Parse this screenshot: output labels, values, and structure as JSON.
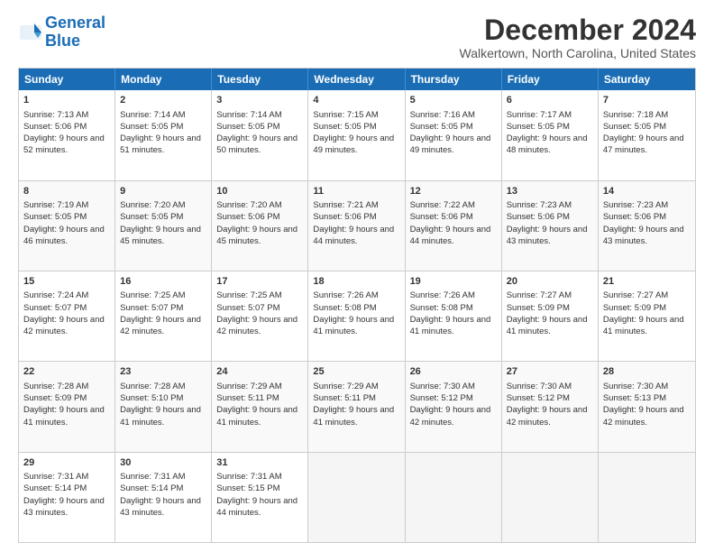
{
  "header": {
    "logo_line1": "General",
    "logo_line2": "Blue",
    "month": "December 2024",
    "location": "Walkertown, North Carolina, United States"
  },
  "days": [
    "Sunday",
    "Monday",
    "Tuesday",
    "Wednesday",
    "Thursday",
    "Friday",
    "Saturday"
  ],
  "weeks": [
    [
      {
        "day": "1",
        "sunrise": "Sunrise: 7:13 AM",
        "sunset": "Sunset: 5:06 PM",
        "daylight": "Daylight: 9 hours and 52 minutes."
      },
      {
        "day": "2",
        "sunrise": "Sunrise: 7:14 AM",
        "sunset": "Sunset: 5:05 PM",
        "daylight": "Daylight: 9 hours and 51 minutes."
      },
      {
        "day": "3",
        "sunrise": "Sunrise: 7:14 AM",
        "sunset": "Sunset: 5:05 PM",
        "daylight": "Daylight: 9 hours and 50 minutes."
      },
      {
        "day": "4",
        "sunrise": "Sunrise: 7:15 AM",
        "sunset": "Sunset: 5:05 PM",
        "daylight": "Daylight: 9 hours and 49 minutes."
      },
      {
        "day": "5",
        "sunrise": "Sunrise: 7:16 AM",
        "sunset": "Sunset: 5:05 PM",
        "daylight": "Daylight: 9 hours and 49 minutes."
      },
      {
        "day": "6",
        "sunrise": "Sunrise: 7:17 AM",
        "sunset": "Sunset: 5:05 PM",
        "daylight": "Daylight: 9 hours and 48 minutes."
      },
      {
        "day": "7",
        "sunrise": "Sunrise: 7:18 AM",
        "sunset": "Sunset: 5:05 PM",
        "daylight": "Daylight: 9 hours and 47 minutes."
      }
    ],
    [
      {
        "day": "8",
        "sunrise": "Sunrise: 7:19 AM",
        "sunset": "Sunset: 5:05 PM",
        "daylight": "Daylight: 9 hours and 46 minutes."
      },
      {
        "day": "9",
        "sunrise": "Sunrise: 7:20 AM",
        "sunset": "Sunset: 5:05 PM",
        "daylight": "Daylight: 9 hours and 45 minutes."
      },
      {
        "day": "10",
        "sunrise": "Sunrise: 7:20 AM",
        "sunset": "Sunset: 5:06 PM",
        "daylight": "Daylight: 9 hours and 45 minutes."
      },
      {
        "day": "11",
        "sunrise": "Sunrise: 7:21 AM",
        "sunset": "Sunset: 5:06 PM",
        "daylight": "Daylight: 9 hours and 44 minutes."
      },
      {
        "day": "12",
        "sunrise": "Sunrise: 7:22 AM",
        "sunset": "Sunset: 5:06 PM",
        "daylight": "Daylight: 9 hours and 44 minutes."
      },
      {
        "day": "13",
        "sunrise": "Sunrise: 7:23 AM",
        "sunset": "Sunset: 5:06 PM",
        "daylight": "Daylight: 9 hours and 43 minutes."
      },
      {
        "day": "14",
        "sunrise": "Sunrise: 7:23 AM",
        "sunset": "Sunset: 5:06 PM",
        "daylight": "Daylight: 9 hours and 43 minutes."
      }
    ],
    [
      {
        "day": "15",
        "sunrise": "Sunrise: 7:24 AM",
        "sunset": "Sunset: 5:07 PM",
        "daylight": "Daylight: 9 hours and 42 minutes."
      },
      {
        "day": "16",
        "sunrise": "Sunrise: 7:25 AM",
        "sunset": "Sunset: 5:07 PM",
        "daylight": "Daylight: 9 hours and 42 minutes."
      },
      {
        "day": "17",
        "sunrise": "Sunrise: 7:25 AM",
        "sunset": "Sunset: 5:07 PM",
        "daylight": "Daylight: 9 hours and 42 minutes."
      },
      {
        "day": "18",
        "sunrise": "Sunrise: 7:26 AM",
        "sunset": "Sunset: 5:08 PM",
        "daylight": "Daylight: 9 hours and 41 minutes."
      },
      {
        "day": "19",
        "sunrise": "Sunrise: 7:26 AM",
        "sunset": "Sunset: 5:08 PM",
        "daylight": "Daylight: 9 hours and 41 minutes."
      },
      {
        "day": "20",
        "sunrise": "Sunrise: 7:27 AM",
        "sunset": "Sunset: 5:09 PM",
        "daylight": "Daylight: 9 hours and 41 minutes."
      },
      {
        "day": "21",
        "sunrise": "Sunrise: 7:27 AM",
        "sunset": "Sunset: 5:09 PM",
        "daylight": "Daylight: 9 hours and 41 minutes."
      }
    ],
    [
      {
        "day": "22",
        "sunrise": "Sunrise: 7:28 AM",
        "sunset": "Sunset: 5:09 PM",
        "daylight": "Daylight: 9 hours and 41 minutes."
      },
      {
        "day": "23",
        "sunrise": "Sunrise: 7:28 AM",
        "sunset": "Sunset: 5:10 PM",
        "daylight": "Daylight: 9 hours and 41 minutes."
      },
      {
        "day": "24",
        "sunrise": "Sunrise: 7:29 AM",
        "sunset": "Sunset: 5:11 PM",
        "daylight": "Daylight: 9 hours and 41 minutes."
      },
      {
        "day": "25",
        "sunrise": "Sunrise: 7:29 AM",
        "sunset": "Sunset: 5:11 PM",
        "daylight": "Daylight: 9 hours and 41 minutes."
      },
      {
        "day": "26",
        "sunrise": "Sunrise: 7:30 AM",
        "sunset": "Sunset: 5:12 PM",
        "daylight": "Daylight: 9 hours and 42 minutes."
      },
      {
        "day": "27",
        "sunrise": "Sunrise: 7:30 AM",
        "sunset": "Sunset: 5:12 PM",
        "daylight": "Daylight: 9 hours and 42 minutes."
      },
      {
        "day": "28",
        "sunrise": "Sunrise: 7:30 AM",
        "sunset": "Sunset: 5:13 PM",
        "daylight": "Daylight: 9 hours and 42 minutes."
      }
    ],
    [
      {
        "day": "29",
        "sunrise": "Sunrise: 7:31 AM",
        "sunset": "Sunset: 5:14 PM",
        "daylight": "Daylight: 9 hours and 43 minutes."
      },
      {
        "day": "30",
        "sunrise": "Sunrise: 7:31 AM",
        "sunset": "Sunset: 5:14 PM",
        "daylight": "Daylight: 9 hours and 43 minutes."
      },
      {
        "day": "31",
        "sunrise": "Sunrise: 7:31 AM",
        "sunset": "Sunset: 5:15 PM",
        "daylight": "Daylight: 9 hours and 44 minutes."
      },
      {
        "day": "",
        "sunrise": "",
        "sunset": "",
        "daylight": ""
      },
      {
        "day": "",
        "sunrise": "",
        "sunset": "",
        "daylight": ""
      },
      {
        "day": "",
        "sunrise": "",
        "sunset": "",
        "daylight": ""
      },
      {
        "day": "",
        "sunrise": "",
        "sunset": "",
        "daylight": ""
      }
    ]
  ]
}
